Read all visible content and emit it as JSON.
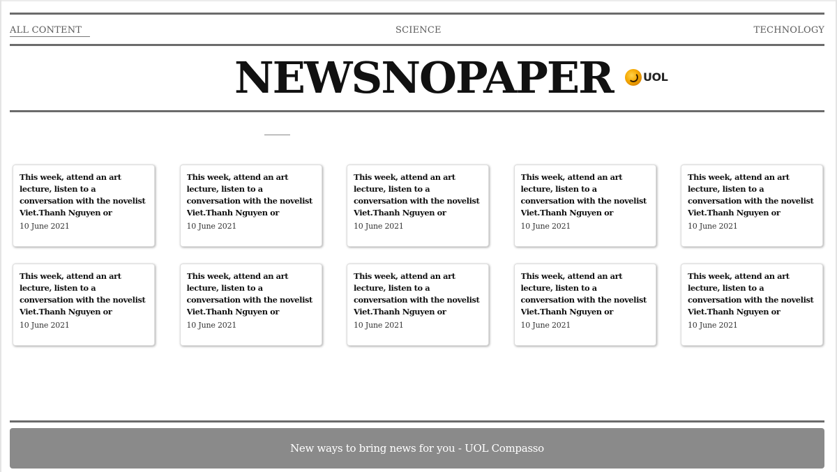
{
  "nav": {
    "all_content": "ALL CONTENT",
    "science": "SCIENCE",
    "technology": "TECHNOLOGY"
  },
  "masthead": {
    "title": "NEWSNOPAPER",
    "logo_text": "UOL",
    "logo_icon": "uol-logo-icon"
  },
  "articles": [
    {
      "title": "This week, attend an art lecture, listen to a conversation with the novelist Viet.Thanh Nguyen or celebrate Deaf History...",
      "date": "10 June 2021"
    },
    {
      "title": "This week, attend an art lecture, listen to a conversation with the novelist Viet.Thanh Nguyen or celebrate Deaf History...",
      "date": "10 June 2021"
    },
    {
      "title": "This week, attend an art lecture, listen to a conversation with the novelist Viet.Thanh Nguyen or celebrate Deaf History...",
      "date": "10 June 2021"
    },
    {
      "title": "This week, attend an art lecture, listen to a conversation with the novelist Viet.Thanh Nguyen or celebrate Deaf History...",
      "date": "10 June 2021"
    },
    {
      "title": "This week, attend an art lecture, listen to a conversation with the novelist Viet.Thanh Nguyen or celebrate Deaf History...",
      "date": "10 June 2021"
    },
    {
      "title": "This week, attend an art lecture, listen to a conversation with the novelist Viet.Thanh Nguyen or celebrate Deaf History...",
      "date": "10 June 2021"
    },
    {
      "title": "This week, attend an art lecture, listen to a conversation with the novelist Viet.Thanh Nguyen or celebrate Deaf History...",
      "date": "10 June 2021"
    },
    {
      "title": "This week, attend an art lecture, listen to a conversation with the novelist Viet.Thanh Nguyen or celebrate Deaf History...",
      "date": "10 June 2021"
    },
    {
      "title": "This week, attend an art lecture, listen to a conversation with the novelist Viet.Thanh Nguyen or celebrate Deaf History...",
      "date": "10 June 2021"
    },
    {
      "title": "This week, attend an art lecture, listen to a conversation with the novelist Viet.Thanh Nguyen or celebrate Deaf History...",
      "date": "10 June 2021"
    }
  ],
  "footer": {
    "text": "New ways to bring news for you - UOL Compasso"
  },
  "colors": {
    "rule": "#6b6b6b",
    "footer_bg": "#8a8a8a",
    "text": "#111111"
  }
}
